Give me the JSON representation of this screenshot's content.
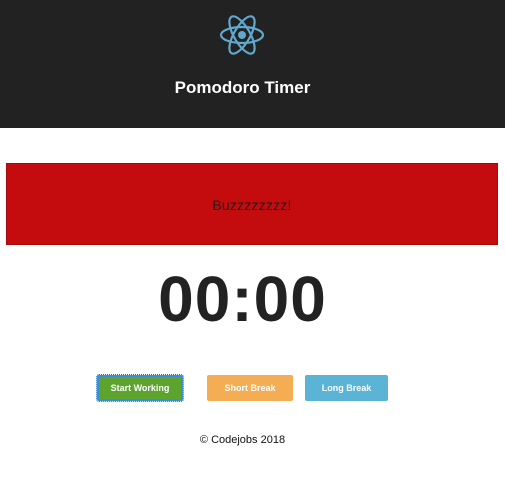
{
  "header": {
    "title": "Pomodoro Timer",
    "logo_icon": "react-atom-icon",
    "background_color": "#222222",
    "logo_color": "#61a8cf"
  },
  "alert": {
    "message": "Buzzzzzzzz!",
    "background_color": "#c40c0e"
  },
  "timer": {
    "display": "00:00"
  },
  "controls": {
    "start_label": "Start Working",
    "short_break_label": "Short Break",
    "long_break_label": "Long Break",
    "start_color": "#5ca42d",
    "short_break_color": "#f4ad53",
    "long_break_color": "#5bb3d6"
  },
  "footer": {
    "copyright": "© Codejobs 2018"
  }
}
